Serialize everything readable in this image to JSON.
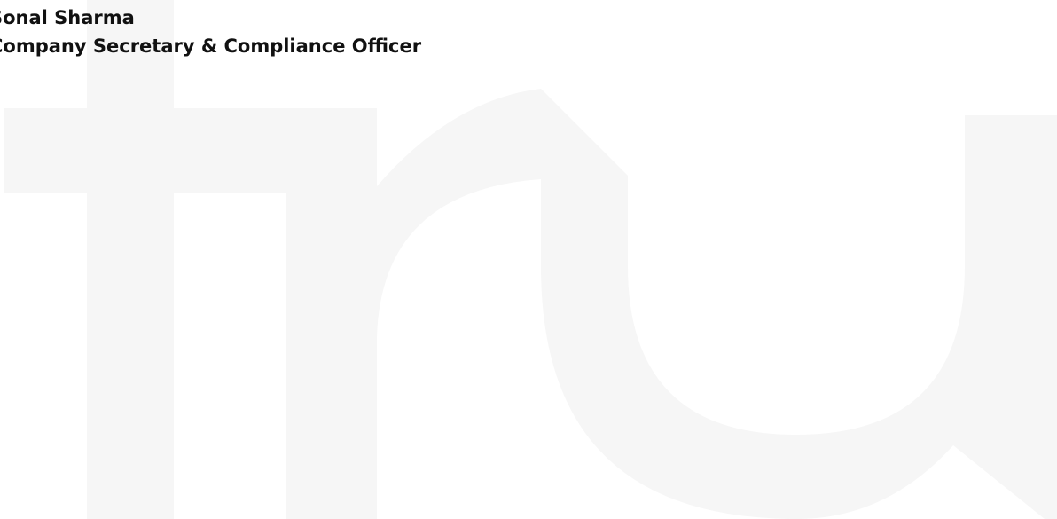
{
  "signatory": {
    "name": "Sonal Sharma",
    "title": "Company Secretary & Compliance Officer"
  },
  "watermark": {
    "icon": "tru-logo-watermark-icon",
    "color": "#f6f6f6"
  }
}
